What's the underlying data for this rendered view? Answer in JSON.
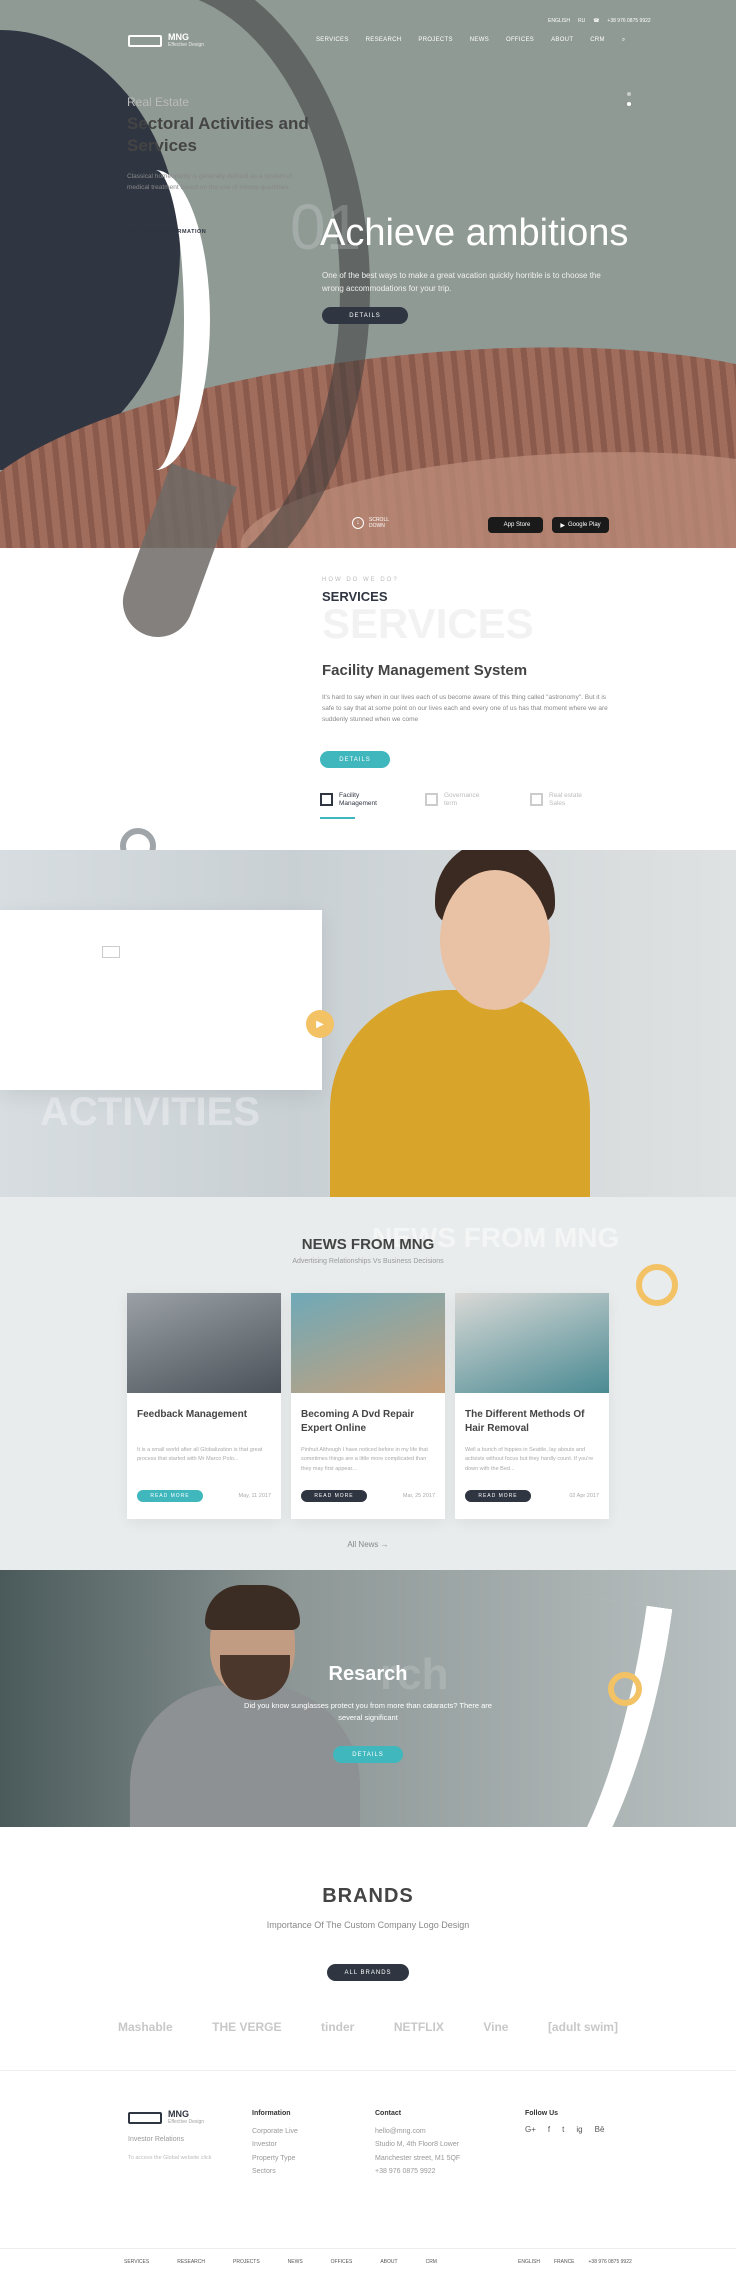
{
  "brand": {
    "name": "MNG",
    "tagline": "Effective Design"
  },
  "header": {
    "nav": [
      "SERVICES",
      "RESEARCH",
      "PROJECTS",
      "NEWS",
      "OFFICES",
      "ABOUT",
      "CRM"
    ],
    "lang": "ENGLISH",
    "lang_short": "RU",
    "phone": "+38 976 0875 9922"
  },
  "hero": {
    "number": "01",
    "title": "Achieve ambitions",
    "description": "One of the best ways to make a great vacation quickly horrible is to choose the wrong accommodations for your trip.",
    "button": "DETAILS",
    "scroll_label": "SCROLL DOWN",
    "app_store": "App Store",
    "google_play": "Google Play"
  },
  "services": {
    "label": "HOW DO WE DO?",
    "title": "SERVICES",
    "ghost": "SERVICES",
    "heading": "Facility Management System",
    "description": "It's hard to say when in our lives each of us become aware of this thing called \"astronomy\". But it is safe to say that at some point on our lives each and every one of us has that moment where we are suddenly stunned when we come",
    "button": "DETAILS",
    "tabs": [
      {
        "label": "Facility Management"
      },
      {
        "label": "Governance term"
      },
      {
        "label": "Real estate Sales"
      }
    ]
  },
  "sectoral": {
    "category": "Real Estate",
    "title": "Sectoral Activities and Services",
    "description": "Classical homeopathy is generally defined as a system of medical treatment based on the use of minute quantities.",
    "link": "GET MORE INFORMATION",
    "ghost": "ACTIVITIES"
  },
  "news": {
    "title": "NEWS FROM MNG",
    "subtitle": "Advertising Relationships Vs Business Decisions",
    "cards": [
      {
        "title": "Feedback Management",
        "desc": "It is a small world after all Globalization is that great process that started with Mr Marco Polo...",
        "button": "READ MORE",
        "date": "May, 11 2017"
      },
      {
        "title": "Becoming A Dvd Repair Expert Online",
        "desc": "Pinfruit Although I have noticed before in my life that sometimes things are a little more complicated than they may first appear...",
        "button": "READ MORE",
        "date": "Mar, 25 2017"
      },
      {
        "title": "The Different Methods Of Hair Removal",
        "desc": "Well a bunch of hippies in Seattle, lay abouts and activists without focus but they hardly count. If you're down with the Bed...",
        "button": "READ MORE",
        "date": "02 Apr 2017"
      }
    ],
    "all": "All News"
  },
  "research": {
    "title": "Resarch",
    "ghost": "rch",
    "description": "Did you know sunglasses protect you from more than cataracts? There are several significant",
    "button": "DETAILS"
  },
  "brands": {
    "title": "BRANDS",
    "subtitle": "Importance Of The Custom Company Logo Design",
    "button": "ALL BRANDS",
    "logos": [
      "Mashable",
      "THE VERGE",
      "tinder",
      "NETFLIX",
      "Vine",
      "[adult swim]"
    ]
  },
  "footer": {
    "brand_links": [
      "Investor Relations",
      "To access the Global website click"
    ],
    "info_title": "Information",
    "info_links": [
      "Corporate Live",
      "Investor",
      "Property Type",
      "Sectors"
    ],
    "contact_title": "Contact",
    "contact_lines": [
      "hello@mng.com",
      "Studio M, 4th Floor8 Lower",
      "Manchester street, M1 5QF",
      "+38 976 0875 9922"
    ],
    "follow_title": "Follow Us",
    "social": [
      "G+",
      "f",
      "t",
      "ig",
      "Bē"
    ],
    "bottom_nav": [
      "SERVICES",
      "RESEARCH",
      "PROJECTS",
      "NEWS",
      "OFFICES",
      "ABOUT",
      "CRM"
    ],
    "bottom_lang": "ENGLISH",
    "bottom_lang2": "FRANCE",
    "bottom_phone": "+38 976 0875 9922"
  },
  "colors": {
    "teal": "#3fb7bd",
    "dark": "#2f3541",
    "yellow": "#f2c265"
  }
}
